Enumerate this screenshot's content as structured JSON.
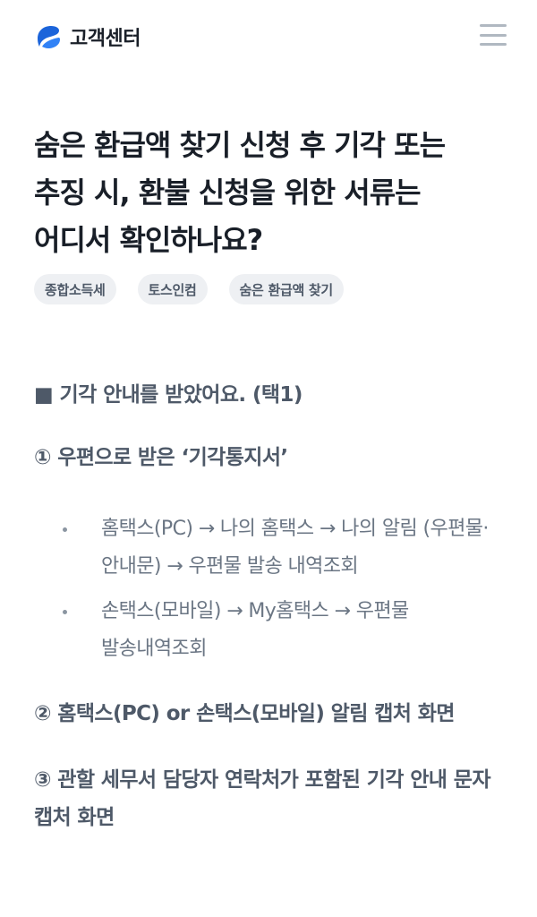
{
  "header": {
    "brand_title": "고객센터",
    "brand_icon": "toss-logo-icon",
    "menu_icon": "hamburger-menu-icon",
    "brand_color": "#1b64da"
  },
  "article": {
    "title": "숨은 환급액 찾기 신청 후 기각 또는 추징 시, 환불 신청을 위한 서류는 어디서 확인하나요?",
    "tags": [
      "종합소득세",
      "토스인컴",
      "숨은 환급액 찾기"
    ],
    "body": {
      "section1_heading": "■ 기각 안내를 받았어요. (택1)",
      "item1_heading": "① 우편으로 받은 ‘기각통지서’",
      "item1_bullets": [
        "홈택스(PC) → 나의 홈택스 → 나의 알림 (우편물·안내문) → 우편물 발송 내역조회",
        "손택스(모바일) → My홈택스 → 우편물 발송내역조회"
      ],
      "item2_heading": "② 홈택스(PC) or 손택스(모바일) 알림 캡처 화면",
      "item3_heading": "③ 관할 세무서 담당자 연락처가 포함된 기각 안내 문자 캡처 화면"
    }
  }
}
